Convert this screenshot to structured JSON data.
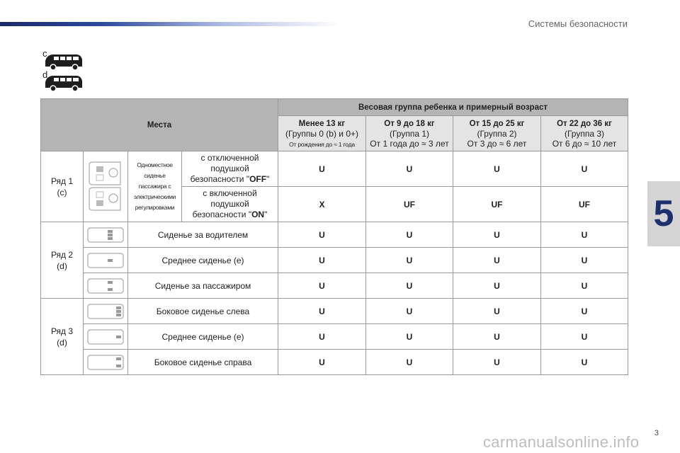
{
  "header": {
    "section_title": "Системы безопасности",
    "chapter_number": "5"
  },
  "vehicles": [
    {
      "letter": "c",
      "icon": "van-icon"
    },
    {
      "letter": "d",
      "icon": "van-icon"
    }
  ],
  "table": {
    "places_header": "Места",
    "weight_group_header": "Весовая группа ребенка и примерный возраст",
    "columns": [
      {
        "title": "Менее 13 кг",
        "group": "(Группы 0 (b) и 0+)",
        "age": "От рождения до ≈ 1 года"
      },
      {
        "title": "От 9 до 18 кг",
        "group": "(Группа 1)",
        "age": "От 1 года до ≈ 3 лет"
      },
      {
        "title": "От 15 до 25 кг",
        "group": "(Группа 2)",
        "age": "От 3 до ≈ 6 лет"
      },
      {
        "title": "От 22 до 36 кг",
        "group": "(Группа 3)",
        "age": "От 6 до ≈ 10 лет"
      }
    ],
    "row1": {
      "label": "Ряд 1",
      "sub": "(c)",
      "seat_desc": "Одноместное сиденье пассажира с электрическими регулировками",
      "conditions": [
        {
          "pre": "с отключенной подушкой безопасности \"",
          "strong": "OFF",
          "post": "\"",
          "values": [
            "U",
            "U",
            "U",
            "U"
          ]
        },
        {
          "pre": "с включенной подушкой безопасности \"",
          "strong": "ON",
          "post": "\"",
          "values": [
            "X",
            "UF",
            "UF",
            "UF"
          ]
        }
      ]
    },
    "row2": {
      "label": "Ряд 2",
      "sub": "(d)",
      "seats": [
        {
          "desc": "Сиденье за водителем",
          "values": [
            "U",
            "U",
            "U",
            "U"
          ]
        },
        {
          "desc": "Среднее сиденье (е)",
          "values": [
            "U",
            "U",
            "U",
            "U"
          ]
        },
        {
          "desc": "Сиденье за пассажиром",
          "values": [
            "U",
            "U",
            "U",
            "U"
          ]
        }
      ]
    },
    "row3": {
      "label": "Ряд 3",
      "sub": "(d)",
      "seats": [
        {
          "desc": "Боковое сиденье слева",
          "values": [
            "U",
            "U",
            "U",
            "U"
          ]
        },
        {
          "desc": "Среднее сиденье (е)",
          "values": [
            "U",
            "U",
            "U",
            "U"
          ]
        },
        {
          "desc": "Боковое сиденье справа",
          "values": [
            "U",
            "U",
            "U",
            "U"
          ]
        }
      ]
    }
  },
  "footer": {
    "page_number": "3",
    "watermark": "carmanualsonline.info"
  },
  "colors": {
    "accent": "#1c2f6e",
    "header_dark": "#b4b4b4",
    "header_light": "#e4e4e4"
  }
}
